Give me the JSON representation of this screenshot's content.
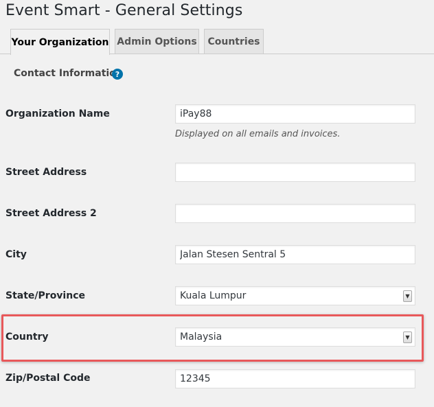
{
  "page": {
    "title": "Event Smart - General Settings"
  },
  "tabs": [
    {
      "label": "Your Organization",
      "active": true
    },
    {
      "label": "Admin Options",
      "active": false
    },
    {
      "label": "Countries",
      "active": false
    }
  ],
  "section": {
    "title": "Contact Information",
    "help_icon": "?"
  },
  "fields": {
    "organization_name": {
      "label": "Organization Name",
      "value": "iPay88",
      "description": "Displayed on all emails and invoices."
    },
    "street_address": {
      "label": "Street Address",
      "value": ""
    },
    "street_address_2": {
      "label": "Street Address 2",
      "value": ""
    },
    "city": {
      "label": "City",
      "value": "Jalan Stesen Sentral 5"
    },
    "state": {
      "label": "State/Province",
      "value": "Kuala Lumpur"
    },
    "country": {
      "label": "Country",
      "value": "Malaysia"
    },
    "zip": {
      "label": "Zip/Postal Code",
      "value": "12345"
    }
  },
  "colors": {
    "highlight": "#e8585a",
    "help_icon": "#0073aa"
  }
}
